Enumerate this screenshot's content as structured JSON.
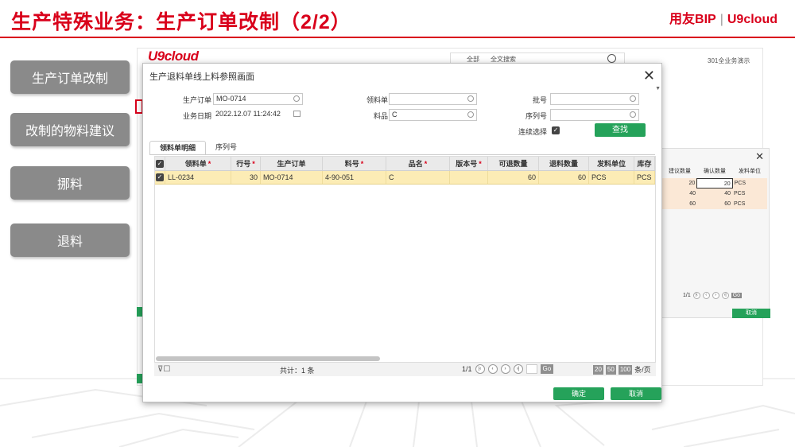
{
  "slide": {
    "title": "生产特殊业务：生产订单改制（2/2）",
    "brand_left": "用友BIP",
    "brand_sep": "|",
    "brand_right": "U9cloud",
    "accent_color": "#d9001b"
  },
  "nav": {
    "items": [
      {
        "label": "生产订单改制"
      },
      {
        "label": "改制的物料建议"
      },
      {
        "label": "挪料"
      },
      {
        "label": "退料"
      }
    ]
  },
  "background_app": {
    "logo": "U9cloud",
    "search_scope": "全部",
    "search_placeholder": "全文搜索",
    "user": "301全业务演示",
    "panel": {
      "headers": [
        "建议数量",
        "确认数量",
        "发料单位"
      ],
      "rows": [
        {
          "suggest": "20",
          "confirm": "20",
          "unit": "PCS"
        },
        {
          "suggest": "40",
          "confirm": "40",
          "unit": "PCS"
        },
        {
          "suggest": "60",
          "confirm": "60",
          "unit": "PCS"
        }
      ],
      "pager": "1/1",
      "go": "Go",
      "cancel": "取消"
    }
  },
  "dialog": {
    "title": "生产退料单线上料参照画面",
    "form": {
      "order_label": "生产订单",
      "order_value": "MO-0714",
      "date_label": "业务日期",
      "date_value": "2022.12.07 11:24:42",
      "issue_label": "领料单",
      "issue_value": "",
      "item_label": "料品",
      "item_value": "C",
      "lot_label": "批号",
      "lot_value": "",
      "serial_label": "序列号",
      "serial_value": "",
      "continuous_label": "连续选择",
      "find_button": "查找"
    },
    "tabs": [
      {
        "label": "领料单明细",
        "active": true
      },
      {
        "label": "序列号",
        "active": false
      }
    ],
    "grid": {
      "columns": [
        {
          "label": "领料单",
          "required": true
        },
        {
          "label": "行号",
          "required": true
        },
        {
          "label": "生产订单",
          "required": false
        },
        {
          "label": "料号",
          "required": true
        },
        {
          "label": "品名",
          "required": true
        },
        {
          "label": "版本号",
          "required": true
        },
        {
          "label": "可退数量",
          "required": false
        },
        {
          "label": "退料数量",
          "required": false
        },
        {
          "label": "发料单位",
          "required": false
        },
        {
          "label": "库存",
          "required": false
        }
      ],
      "rows": [
        {
          "issue_doc": "LL-0234",
          "line_no": "30",
          "mo": "MO-0714",
          "item_code": "4-90-051",
          "item_name": "C",
          "version": "",
          "returnable_qty": "60",
          "return_qty": "60",
          "unit": "PCS",
          "stock_unit": "PCS"
        }
      ]
    },
    "footer": {
      "total_text": "共计：1 条",
      "page": "1/1",
      "go": "Go",
      "size_20": "20",
      "size_50": "50",
      "size_100": "100",
      "per_page": "条/页"
    },
    "ok_button": "确定",
    "cancel_button": "取消"
  },
  "colors": {
    "green": "#25a25a",
    "row_highlight": "#fcecb5",
    "nav_gray": "#8a8a8a"
  }
}
